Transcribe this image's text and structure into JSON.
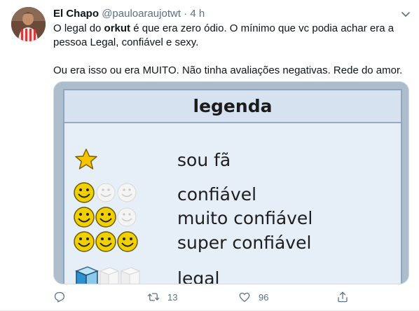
{
  "tweet": {
    "display_name": "El Chapo",
    "handle": "@pauloaraujotwt",
    "separator": "·",
    "time": "4 h",
    "text_line1_pre": "O legal do ",
    "text_line1_bold": "orkut",
    "text_line1_post": " é que era zero ódio. O mínimo que vc podia achar era a pessoa Legal, confiável e sexy.",
    "text_line2": "Ou era isso ou era MUITO. Não tinha avaliações negativas. Rede do amor."
  },
  "media": {
    "title": "legenda",
    "rows": [
      {
        "label": "sou fã"
      },
      {
        "label": "confiável"
      },
      {
        "label": "muito confiável"
      },
      {
        "label": "super confiável"
      },
      {
        "label": "legal"
      }
    ]
  },
  "actions": {
    "reply_count": "",
    "retweet_count": "13",
    "like_count": "96"
  },
  "icons": [
    "caret-down-icon",
    "reply-icon",
    "retweet-icon",
    "like-icon",
    "share-icon"
  ],
  "colors": {
    "secondary_text": "#5b7083",
    "smiley_yellow": "#f0d000",
    "smiley_empty": "#f2f2f2",
    "star_gold": "#f5c400"
  }
}
